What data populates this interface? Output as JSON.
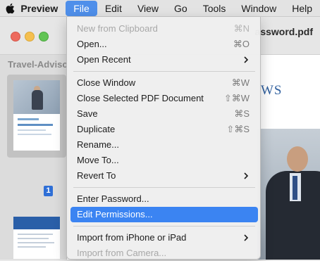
{
  "menubar": {
    "apple_icon": "apple-logo-icon",
    "items": [
      "Preview",
      "File",
      "Edit",
      "View",
      "Go",
      "Tools",
      "Window",
      "Help"
    ]
  },
  "window": {
    "title": "assword.pdf",
    "sidebar_title": "Travel-Advisor",
    "page_badge": "1",
    "doc_heading": "WS"
  },
  "file_menu": {
    "new_from_clipboard": {
      "label": "New from Clipboard",
      "shortcut": "⌘N"
    },
    "open": {
      "label": "Open...",
      "shortcut": "⌘O"
    },
    "open_recent": {
      "label": "Open Recent"
    },
    "close_window": {
      "label": "Close Window",
      "shortcut": "⌘W"
    },
    "close_selected": {
      "label": "Close Selected PDF Document",
      "shortcut": "⇧⌘W"
    },
    "save": {
      "label": "Save",
      "shortcut": "⌘S"
    },
    "duplicate": {
      "label": "Duplicate",
      "shortcut": "⇧⌘S"
    },
    "rename": {
      "label": "Rename..."
    },
    "move_to": {
      "label": "Move To..."
    },
    "revert_to": {
      "label": "Revert To"
    },
    "enter_password": {
      "label": "Enter Password..."
    },
    "edit_permissions": {
      "label": "Edit Permissions..."
    },
    "import_iphone": {
      "label": "Import from iPhone or iPad"
    },
    "import_camera": {
      "label": "Import from Camera..."
    }
  },
  "colors": {
    "highlight": "#3b84f2",
    "menubar_active": "#4f8fea"
  }
}
